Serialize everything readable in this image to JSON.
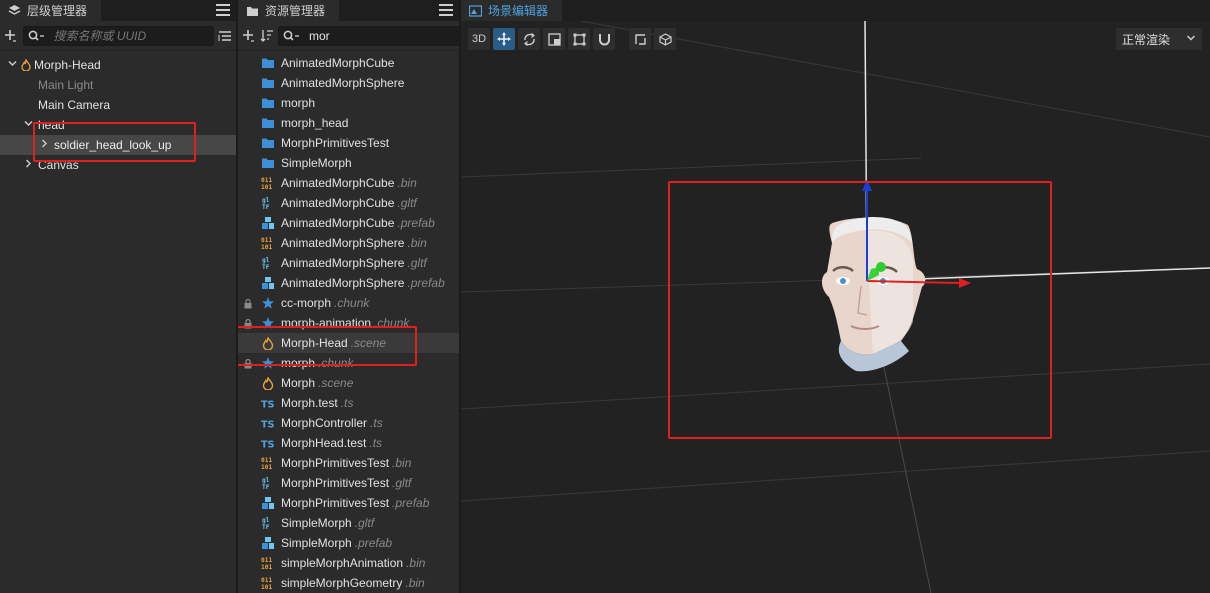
{
  "hierarchy": {
    "tab_label": "层级管理器",
    "search_placeholder": "搜索名称或 UUID",
    "nodes": [
      {
        "label": "Morph-Head"
      },
      {
        "label": "Main Light"
      },
      {
        "label": "Main Camera"
      },
      {
        "label": "head"
      },
      {
        "label": "soldier_head_look_up"
      },
      {
        "label": "Canvas"
      }
    ]
  },
  "assets": {
    "tab_label": "资源管理器",
    "search_value": "mor",
    "items": [
      {
        "name": "AnimatedMorphCube",
        "ext": "",
        "icon": "folder-icon"
      },
      {
        "name": "AnimatedMorphSphere",
        "ext": "",
        "icon": "folder-icon"
      },
      {
        "name": "morph",
        "ext": "",
        "icon": "folder-icon"
      },
      {
        "name": "morph_head",
        "ext": "",
        "icon": "folder-icon"
      },
      {
        "name": "MorphPrimitivesTest",
        "ext": "",
        "icon": "folder-icon"
      },
      {
        "name": "SimpleMorph",
        "ext": "",
        "icon": "folder-icon"
      },
      {
        "name": "AnimatedMorphCube",
        "ext": ".bin",
        "icon": "bin-icon"
      },
      {
        "name": "AnimatedMorphCube",
        "ext": ".gltf",
        "icon": "gltf-icon"
      },
      {
        "name": "AnimatedMorphCube",
        "ext": ".prefab",
        "icon": "prefab-icon"
      },
      {
        "name": "AnimatedMorphSphere",
        "ext": ".bin",
        "icon": "bin-icon"
      },
      {
        "name": "AnimatedMorphSphere",
        "ext": ".gltf",
        "icon": "gltf-icon"
      },
      {
        "name": "AnimatedMorphSphere",
        "ext": ".prefab",
        "icon": "prefab-icon"
      },
      {
        "name": "cc-morph",
        "ext": ".chunk",
        "icon": "chunk-icon"
      },
      {
        "name": "morph-animation",
        "ext": ".chunk",
        "icon": "chunk-icon"
      },
      {
        "name": "Morph-Head",
        "ext": ".scene",
        "icon": "scene-icon"
      },
      {
        "name": "morph",
        "ext": ".chunk",
        "icon": "chunk-icon"
      },
      {
        "name": "Morph",
        "ext": ".scene",
        "icon": "scene-icon"
      },
      {
        "name": "Morph.test",
        "ext": ".ts",
        "icon": "ts-icon"
      },
      {
        "name": "MorphController",
        "ext": ".ts",
        "icon": "ts-icon"
      },
      {
        "name": "MorphHead.test",
        "ext": ".ts",
        "icon": "ts-icon"
      },
      {
        "name": "MorphPrimitivesTest",
        "ext": ".bin",
        "icon": "bin-icon"
      },
      {
        "name": "MorphPrimitivesTest",
        "ext": ".gltf",
        "icon": "gltf-icon"
      },
      {
        "name": "MorphPrimitivesTest",
        "ext": ".prefab",
        "icon": "prefab-icon"
      },
      {
        "name": "SimpleMorph",
        "ext": ".gltf",
        "icon": "gltf-icon"
      },
      {
        "name": "SimpleMorph",
        "ext": ".prefab",
        "icon": "prefab-icon"
      },
      {
        "name": "simpleMorphAnimation",
        "ext": ".bin",
        "icon": "bin-icon"
      },
      {
        "name": "simpleMorphGeometry",
        "ext": ".bin",
        "icon": "bin-icon"
      }
    ]
  },
  "scene": {
    "tab_label": "场景编辑器",
    "btn_3d": "3D",
    "render_mode": "正常渲染"
  },
  "colors": {
    "accent": "#4fa3e0",
    "highlight_box": "#e0201c",
    "folder": "#3d8fd6",
    "scene_icon": "#e9a23b"
  }
}
